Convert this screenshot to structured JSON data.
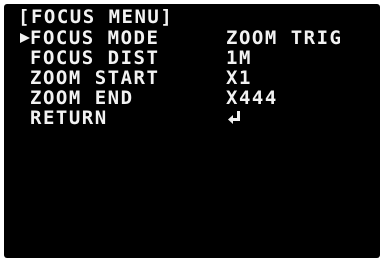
{
  "menu": {
    "title": "[FOCUS MENU]",
    "items": [
      {
        "label": "FOCUS MODE",
        "value": "ZOOM TRIG",
        "selected": true
      },
      {
        "label": "FOCUS DIST",
        "value": "1M",
        "selected": false
      },
      {
        "label": "ZOOM START",
        "value": "X1",
        "selected": false
      },
      {
        "label": "ZOOM END",
        "value": "X444",
        "selected": false
      },
      {
        "label": "RETURN",
        "value_icon": "return-arrow-icon",
        "selected": false
      }
    ],
    "cursor_icon": "selection-cursor-icon"
  },
  "colors": {
    "background": "#000000",
    "text": "#f2f2f2"
  }
}
